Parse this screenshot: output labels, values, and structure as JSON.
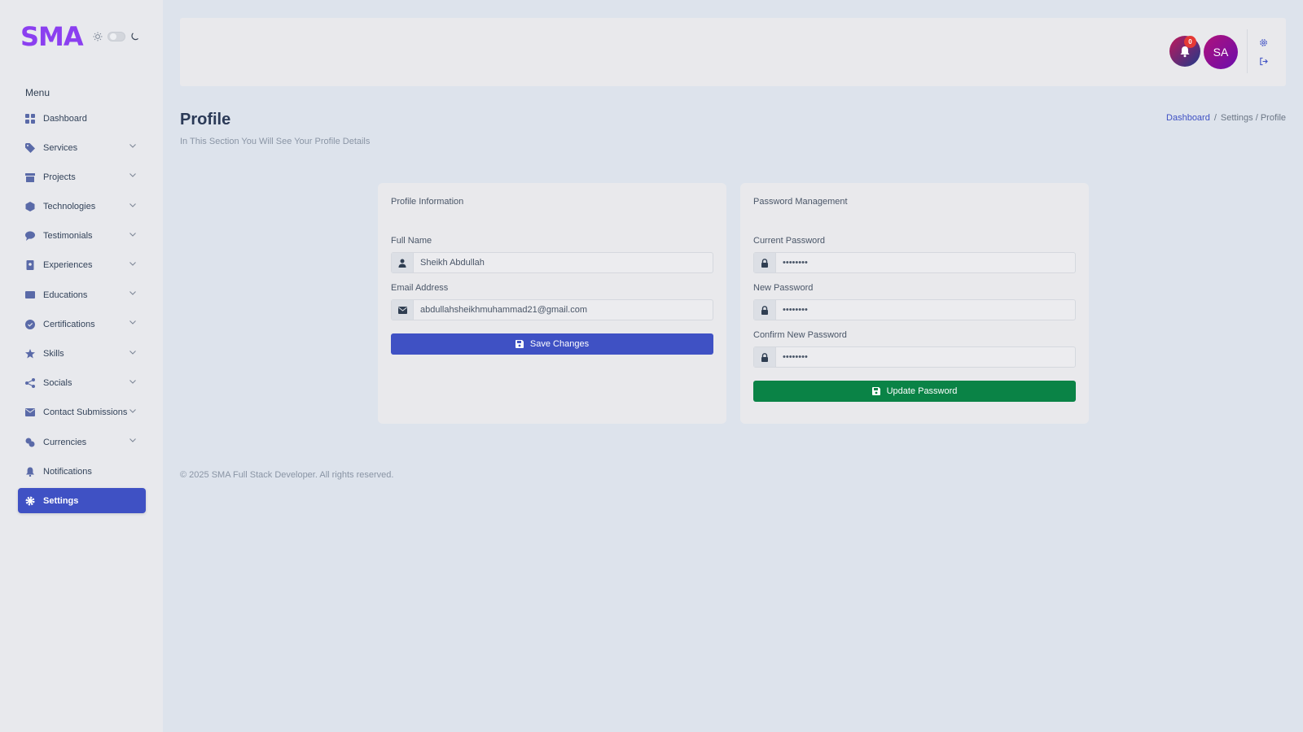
{
  "brand": {
    "logo": "SMA"
  },
  "colors": {
    "primary": "#3f51c4",
    "success": "#0a8346",
    "brand": "#8b3ff0",
    "danger": "#e53935"
  },
  "sidebar": {
    "menu_title": "Menu",
    "items": [
      {
        "label": "Dashboard",
        "icon": "grid-icon",
        "has_submenu": false,
        "active": false
      },
      {
        "label": "Services",
        "icon": "tag-icon",
        "has_submenu": true,
        "active": false
      },
      {
        "label": "Projects",
        "icon": "archive-icon",
        "has_submenu": true,
        "active": false
      },
      {
        "label": "Technologies",
        "icon": "cube-icon",
        "has_submenu": true,
        "active": false
      },
      {
        "label": "Testimonials",
        "icon": "comment-icon",
        "has_submenu": true,
        "active": false
      },
      {
        "label": "Experiences",
        "icon": "badge-icon",
        "has_submenu": true,
        "active": false
      },
      {
        "label": "Educations",
        "icon": "book-icon",
        "has_submenu": true,
        "active": false
      },
      {
        "label": "Certifications",
        "icon": "certificate-icon",
        "has_submenu": true,
        "active": false
      },
      {
        "label": "Skills",
        "icon": "star-icon",
        "has_submenu": true,
        "active": false
      },
      {
        "label": "Socials",
        "icon": "share-icon",
        "has_submenu": true,
        "active": false
      },
      {
        "label": "Contact Submissions",
        "icon": "envelope-icon",
        "has_submenu": true,
        "active": false
      },
      {
        "label": "Currencies",
        "icon": "coins-icon",
        "has_submenu": true,
        "active": false
      },
      {
        "label": "Notifications",
        "icon": "bell-icon",
        "has_submenu": false,
        "active": false
      },
      {
        "label": "Settings",
        "icon": "gear-icon",
        "has_submenu": false,
        "active": true
      }
    ]
  },
  "topbar": {
    "notification_count": "0",
    "avatar_initials": "SA"
  },
  "page": {
    "title": "Profile",
    "subtitle": "In This Section You Will See Your Profile Details",
    "breadcrumb": {
      "home": "Dashboard",
      "separator": "/",
      "trail": "Settings / Profile"
    }
  },
  "profile_card": {
    "title": "Profile Information",
    "full_name_label": "Full Name",
    "full_name_value": "Sheikh Abdullah",
    "email_label": "Email Address",
    "email_value": "abdullahsheikhmuhammad21@gmail.com",
    "save_label": "Save Changes"
  },
  "password_card": {
    "title": "Password Management",
    "current_label": "Current Password",
    "current_value": "••••••••",
    "new_label": "New Password",
    "new_value": "••••••••",
    "confirm_label": "Confirm New Password",
    "confirm_value": "••••••••",
    "update_label": "Update Password"
  },
  "footer": {
    "text": "© 2025 SMA Full Stack Developer. All rights reserved."
  }
}
